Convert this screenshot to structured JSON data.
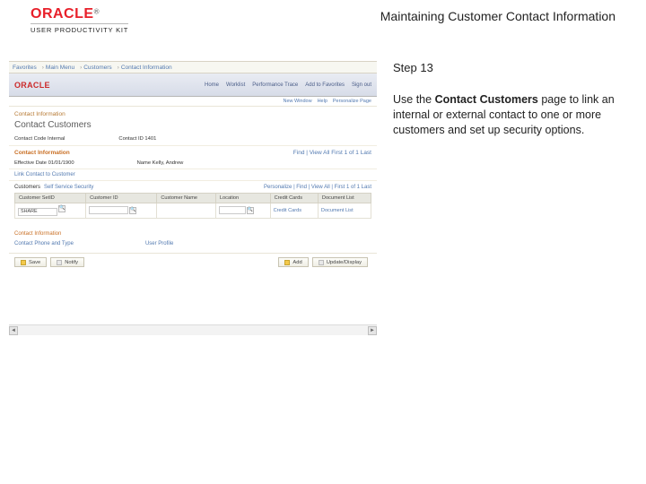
{
  "brand": {
    "name": "ORACLE",
    "tm": "®",
    "subtitle": "USER PRODUCTIVITY KIT"
  },
  "doc_title": "Maintaining Customer Contact Information",
  "step": {
    "title": "Step 13",
    "body_pre": "Use the ",
    "body_bold": "Contact Customers",
    "body_post": " page to link an internal or external contact to one or more customers and set up security options."
  },
  "app": {
    "breadcrumb": [
      "Favorites",
      "Main Menu",
      "Customers",
      "Contact Information"
    ],
    "logo": "ORACLE",
    "tabs": [
      "Home",
      "Worklist",
      "Performance Trace",
      "Add to Favorites",
      "Sign out"
    ],
    "subbar": [
      "New Window",
      "Help",
      "Personalize Page"
    ],
    "section_label": "Contact Information",
    "page_title": "Contact Customers",
    "info_fields": {
      "code": "Contact Code   Internal",
      "id": "Contact ID   1401"
    },
    "contact_info_label": "Contact Information",
    "contact_right": "Find | View All    First 1 of 1 Last",
    "meta": {
      "eff": "Effective Date  01/01/1900",
      "name": "Name  Kelly, Andrew"
    },
    "link_line": "Link Contact to Customer",
    "grid_label": "Customers",
    "grid_accordion": "Self Service Security",
    "grid_right": "Personalize | Find | View All |  First 1 of 1 Last",
    "columns": [
      "Customer SetID",
      "Customer ID",
      "Customer Name",
      "Location",
      "Credit Cards",
      "Document List"
    ],
    "row": {
      "setid": "SHARE",
      "custid": "",
      "custname": "",
      "loc": "",
      "cc": "Credit Cards",
      "doc": "Document List"
    },
    "sub_links": {
      "h1": "Contact Information",
      "l1": "Contact Phone and Type",
      "l2": "User Profile"
    },
    "buttons": {
      "save": "Save",
      "notify": "Notify",
      "add": "Add",
      "update": "Update/Display"
    }
  }
}
